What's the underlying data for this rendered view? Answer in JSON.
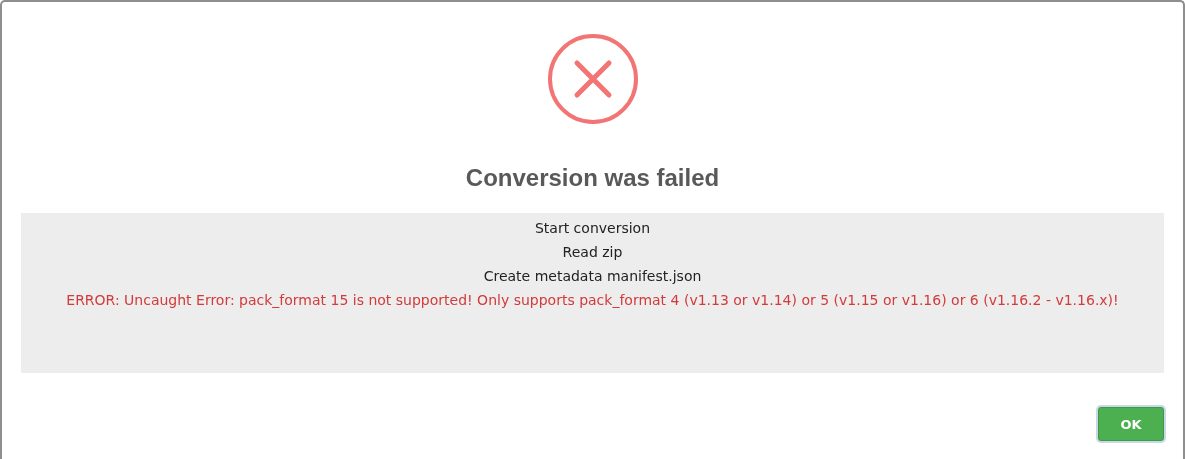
{
  "dialog": {
    "icon": {
      "kind": "error"
    },
    "title": "Conversion was failed",
    "log": [
      {
        "text": "Start conversion",
        "kind": "info"
      },
      {
        "text": "Read zip",
        "kind": "info"
      },
      {
        "text": "Create metadata manifest.json",
        "kind": "info"
      },
      {
        "text": "ERROR: Uncaught Error: pack_format 15 is not supported! Only supports pack_format 4 (v1.13 or v1.14) or 5 (v1.15 or v1.16) or 6 (v1.16.2 - v1.16.x)!",
        "kind": "error"
      }
    ],
    "buttons": [
      {
        "label": "OK",
        "focused": true
      }
    ]
  }
}
